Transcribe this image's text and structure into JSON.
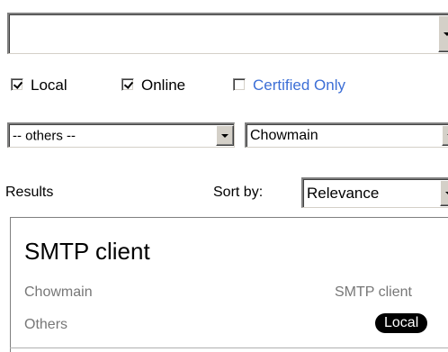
{
  "top_combo": {
    "value": ""
  },
  "filters": {
    "local": {
      "label": "Local",
      "checked": true
    },
    "online": {
      "label": "Online",
      "checked": true
    },
    "certified_only": {
      "label": "Certified Only",
      "checked": false
    }
  },
  "category_select": {
    "value": "-- others --"
  },
  "vendor_select": {
    "value": "Chowmain"
  },
  "results": {
    "label": "Results",
    "sort_label": "Sort by:",
    "sort_value": "Relevance"
  },
  "result_item": {
    "title": "SMTP client",
    "vendor": "Chowmain",
    "category": "Others",
    "type_label": "SMTP client",
    "source_badge": "Local"
  },
  "colors": {
    "link": "#3d6fd6",
    "muted_text": "#777777",
    "badge_bg": "#000000"
  },
  "icons": {
    "dropdown": "chevron-down-icon",
    "checkbox_checked": "checkmark-icon"
  }
}
